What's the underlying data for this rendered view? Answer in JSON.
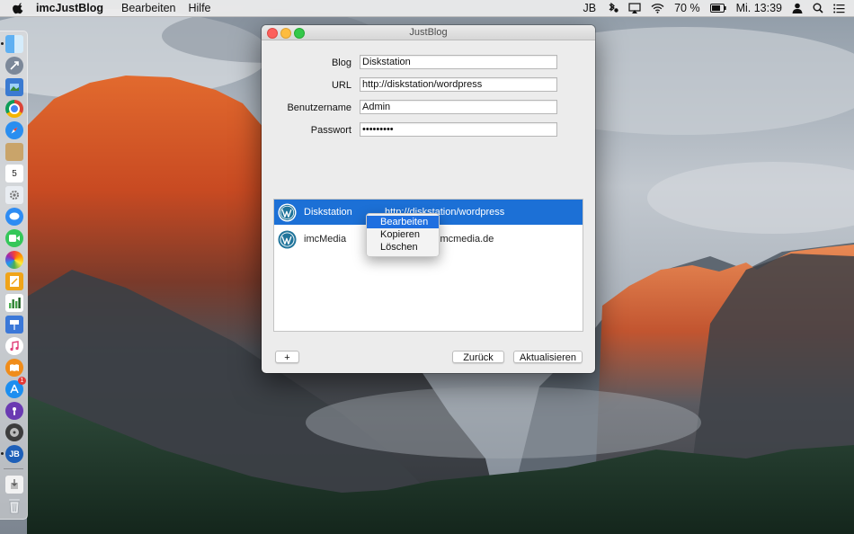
{
  "menubar": {
    "app_name": "imcJustBlog",
    "menus": [
      "Bearbeiten",
      "Hilfe"
    ],
    "user_initials": "JB",
    "battery": "70 %",
    "clock": "Mi. 13:39"
  },
  "window": {
    "title": "JustBlog",
    "form": {
      "blog_label": "Blog",
      "blog_value": "Diskstation",
      "url_label": "URL",
      "url_value": "http://diskstation/wordpress",
      "username_label": "Benutzername",
      "username_value": "Admin",
      "password_label": "Passwort",
      "password_value": "•••••••••"
    },
    "blogs": [
      {
        "name": "Diskstation",
        "url": "http://diskstation/wordpress"
      },
      {
        "name": "imcMedia",
        "url": "imcmedia.de"
      }
    ],
    "buttons": {
      "add": "+",
      "back": "Zurück",
      "refresh": "Aktualisieren"
    }
  },
  "context_menu": {
    "items": [
      "Bearbeiten",
      "Kopieren",
      "Löschen"
    ]
  },
  "dock": {
    "calendar_day": "5",
    "app_store_badge": "1",
    "justblog_badge": "JB"
  },
  "colors": {
    "selection": "#1c70d6",
    "menu_highlight": "#1f6fe0",
    "close": "#fc605c",
    "minimize": "#fdbc40",
    "zoom": "#34c84a",
    "wordpress": "#21759b"
  }
}
